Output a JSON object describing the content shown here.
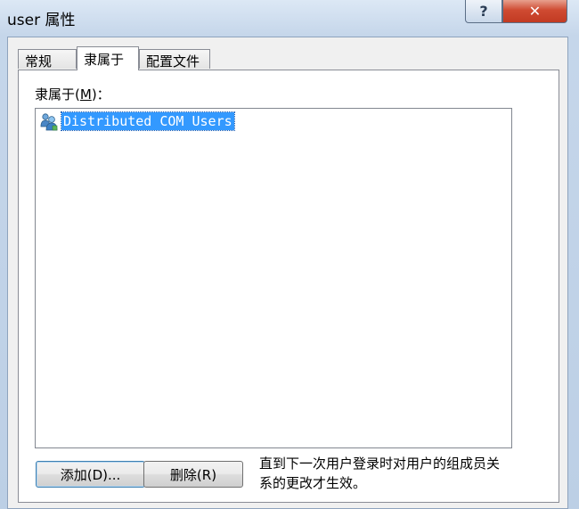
{
  "window": {
    "title": "user 属性",
    "help_label": "?",
    "close_label": "✕"
  },
  "tabs": [
    {
      "label": "常规",
      "active": false
    },
    {
      "label": "隶属于",
      "active": true
    },
    {
      "label": "配置文件",
      "active": false
    }
  ],
  "member_of": {
    "label_prefix": "隶属于(",
    "label_hotkey": "M",
    "label_suffix": ")：",
    "items": [
      {
        "name": "Distributed COM Users",
        "icon": "group-icon",
        "selected": true
      }
    ]
  },
  "buttons": {
    "add_label": "添加(D)...",
    "remove_label": "删除(R)"
  },
  "note": "直到下一次用户登录时对用户的组成员关系的更改才生效。"
}
